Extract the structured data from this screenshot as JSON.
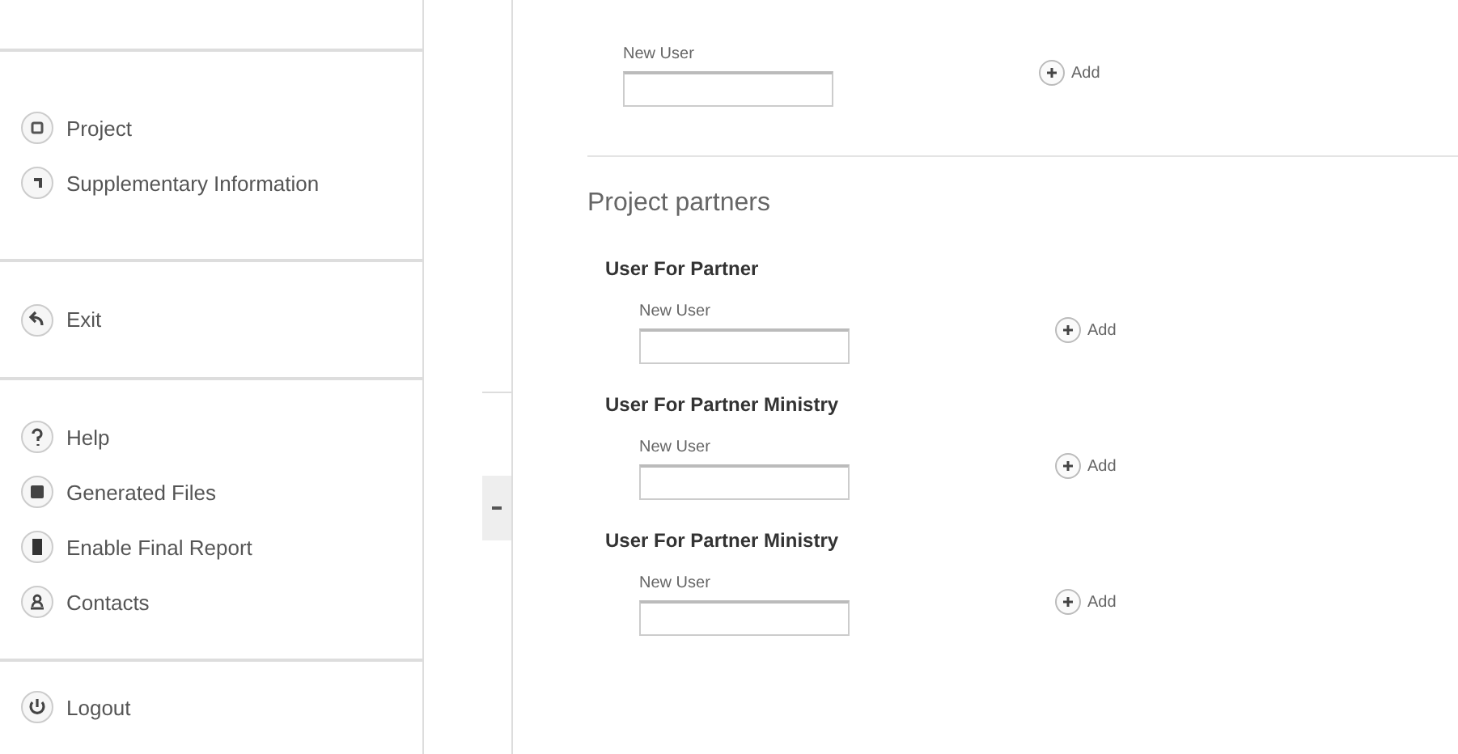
{
  "sidebar": {
    "groups": [
      {
        "items": [
          {
            "label": "Project",
            "kind": "project"
          },
          {
            "label": "Supplementary Information",
            "kind": "info"
          }
        ]
      },
      {
        "items": [
          {
            "label": "Exit",
            "kind": "exit"
          }
        ]
      },
      {
        "items": [
          {
            "label": "Help",
            "kind": "help"
          },
          {
            "label": "Generated Files",
            "kind": "files"
          },
          {
            "label": "Enable Final Report",
            "kind": "report"
          },
          {
            "label": "Contacts",
            "kind": "contacts"
          }
        ]
      },
      {
        "items": [
          {
            "label": "Logout",
            "kind": "logout"
          }
        ]
      }
    ]
  },
  "top_field": {
    "label": "New User",
    "add": "Add"
  },
  "section_title": "Project partners",
  "partners": [
    {
      "title": "User For Partner",
      "label": "New User",
      "add": "Add"
    },
    {
      "title": "User For Partner Ministry",
      "label": "New User",
      "add": "Add"
    },
    {
      "title": "User For Partner Ministry",
      "label": "New User",
      "add": "Add"
    }
  ]
}
